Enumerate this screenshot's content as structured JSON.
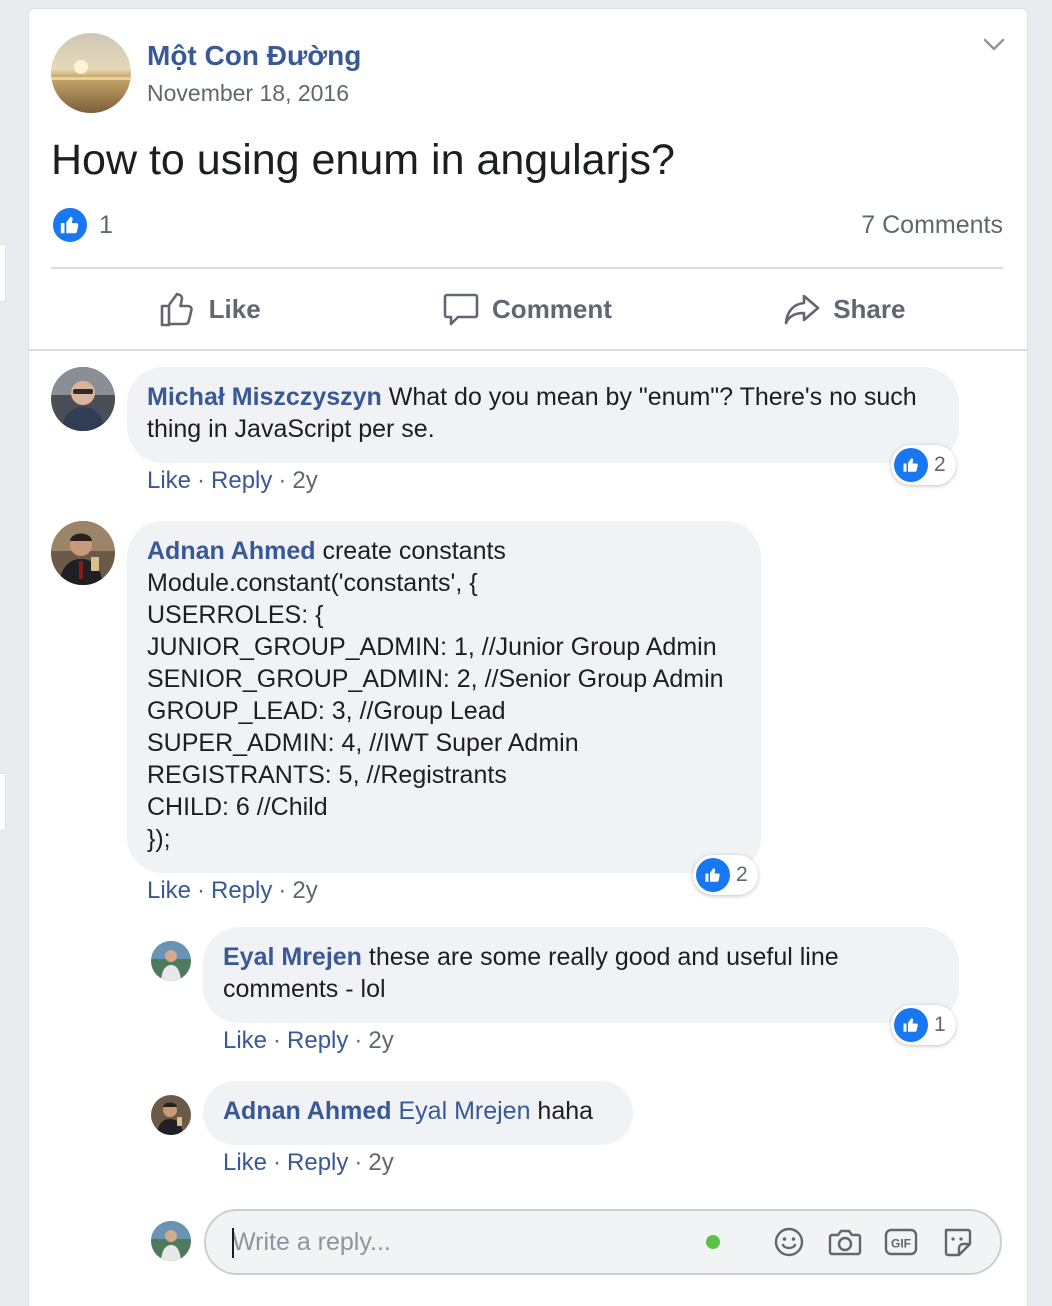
{
  "post": {
    "page_name": "Một Con Đường",
    "date": "November 18, 2016",
    "text": "How to using enum in angularjs?",
    "reaction_count": "1",
    "comments_count": "7 Comments"
  },
  "actions": {
    "like": "Like",
    "comment": "Comment",
    "share": "Share"
  },
  "comments": [
    {
      "author": "Michał Miszczyszyn",
      "text": " What do you mean by \"enum\"? There's no such thing in JavaScript per se.",
      "like": "Like",
      "reply": "Reply",
      "age": "2y",
      "reactions": "2"
    },
    {
      "author": "Adnan Ahmed",
      "lines": [
        " create constants",
        "Module.constant('constants', {",
        "USERROLES: {",
        "JUNIOR_GROUP_ADMIN: 1, //Junior Group Admin",
        "SENIOR_GROUP_ADMIN: 2, //Senior Group Admin",
        "GROUP_LEAD: 3, //Group Lead",
        "SUPER_ADMIN: 4, //IWT Super Admin",
        "REGISTRANTS: 5, //Registrants",
        "CHILD: 6 //Child",
        "});"
      ],
      "like": "Like",
      "reply": "Reply",
      "age": "2y",
      "reactions": "2"
    }
  ],
  "replies": [
    {
      "author": "Eyal Mrejen",
      "text": " these are some really good and useful line comments - lol",
      "like": "Like",
      "reply": "Reply",
      "age": "2y",
      "reactions": "1"
    },
    {
      "author": "Adnan Ahmed",
      "mention": "Eyal Mrejen",
      "text": " haha",
      "like": "Like",
      "reply": "Reply",
      "age": "2y"
    }
  ],
  "reply_box": {
    "placeholder": "Write a reply..."
  },
  "colors": {
    "link": "#385898",
    "like_blue": "#1877f2",
    "bubble_bg": "#f0f2f5",
    "online_green": "#42b72a"
  }
}
